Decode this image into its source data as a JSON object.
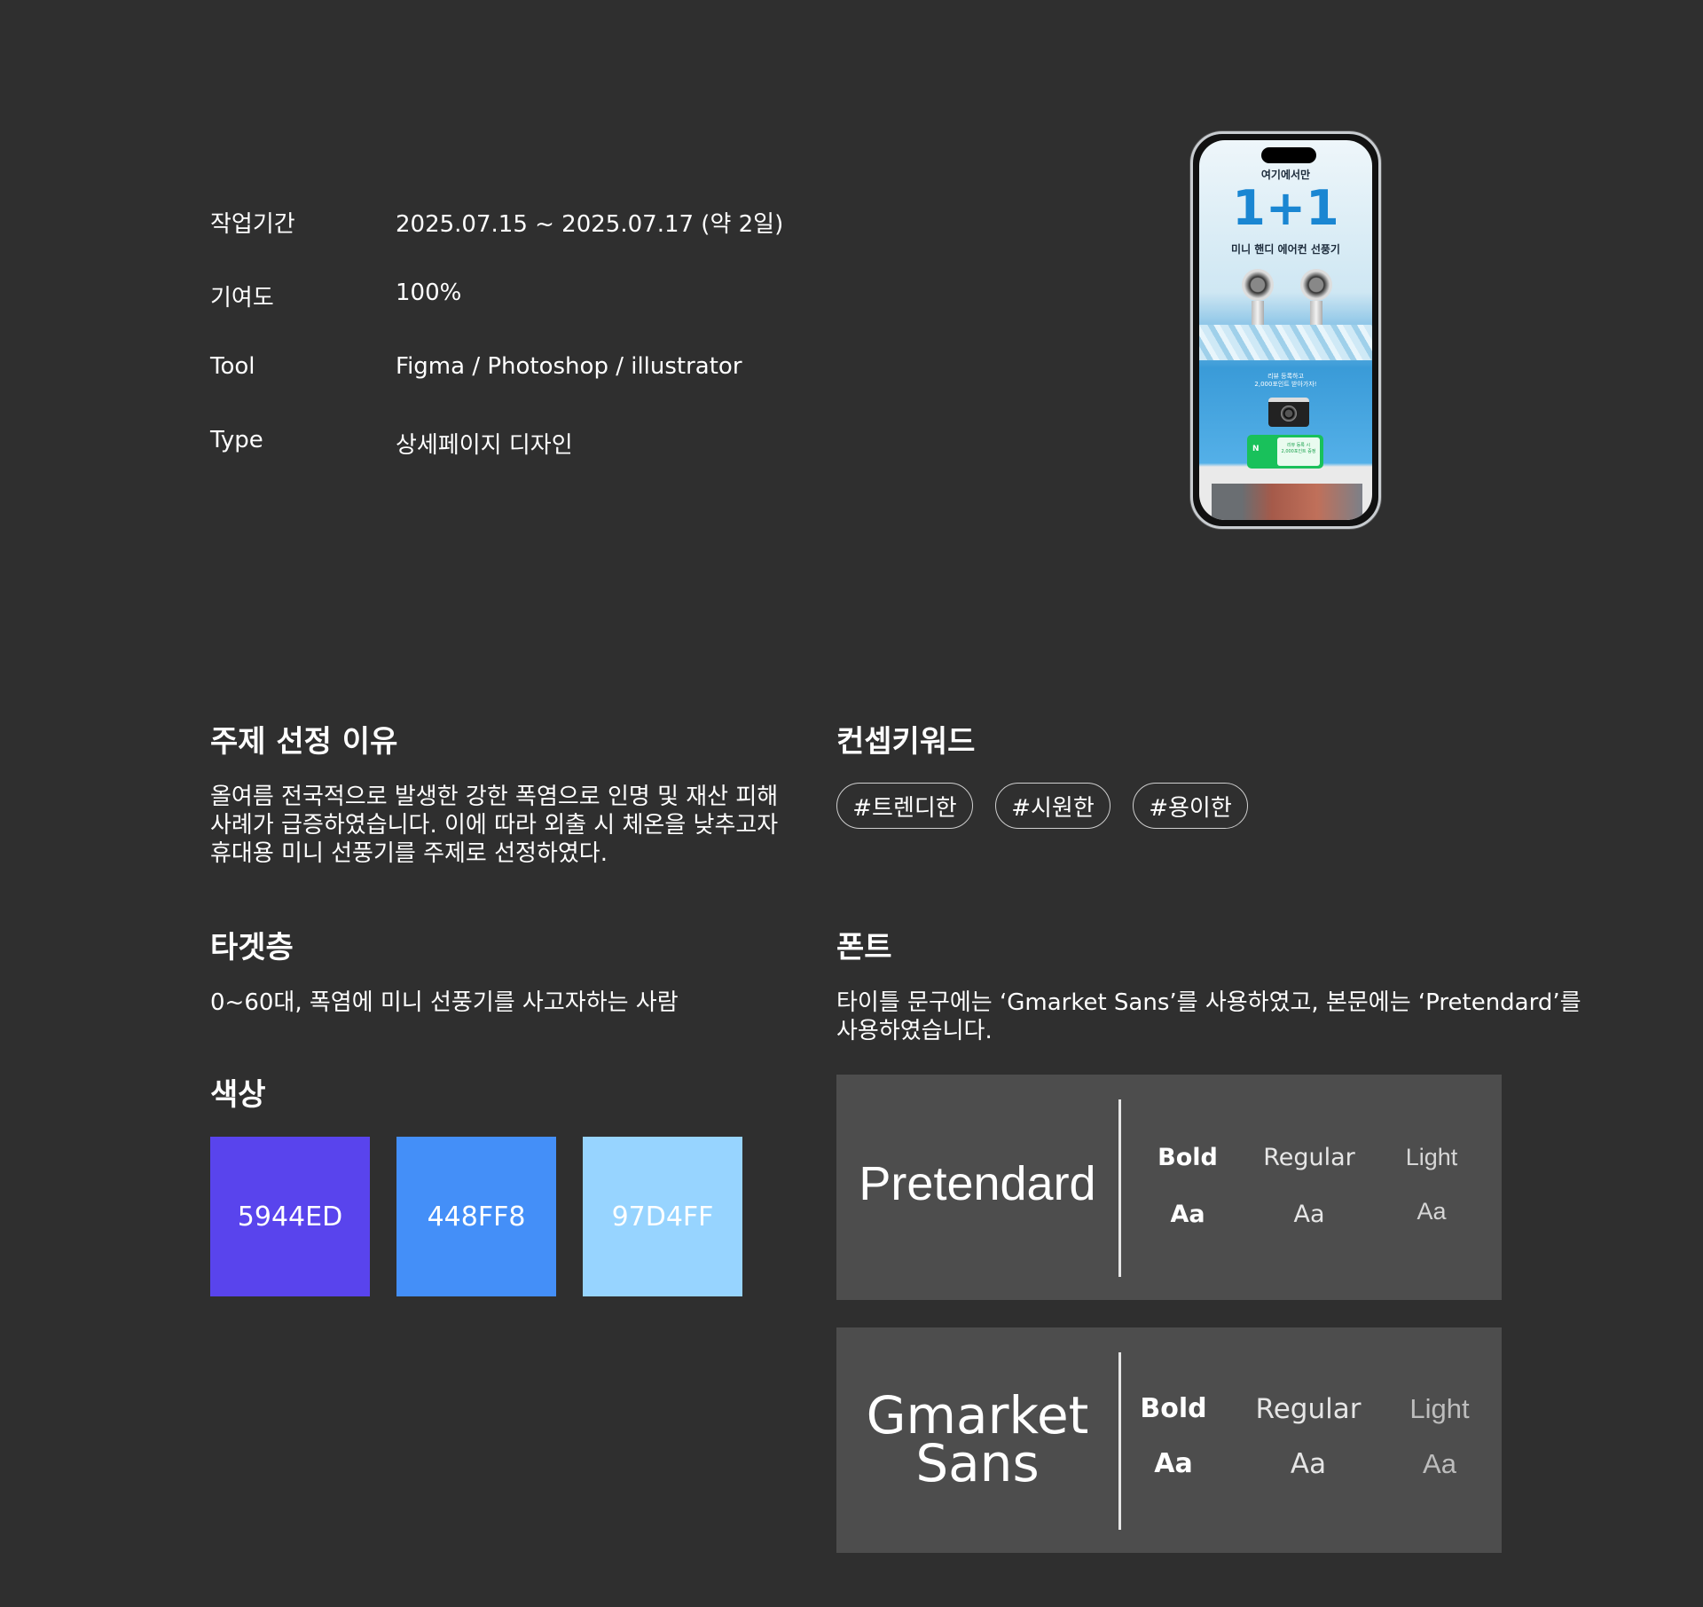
{
  "info": [
    {
      "label": "작업기간",
      "value": "2025.07.15 ~ 2025.07.17 (약 2일)"
    },
    {
      "label": "기여도",
      "value": "100%"
    },
    {
      "label": "Tool",
      "value": "Figma / Photoshop / illustrator"
    },
    {
      "label": "Type",
      "value": "상세페이지 디자인"
    }
  ],
  "phone": {
    "top_text": "여기에서만",
    "big_text": "1+1",
    "product_text": "미니 핸디 에어컨 선풍기",
    "review_line1": "리뷰 등록하고",
    "review_line2": "2,000포인트 받아가자!",
    "npay_line1": "리뷰 등록 시",
    "npay_line2": "2,000포인트 증정"
  },
  "topic": {
    "title": "주제 선정 이유",
    "lines": [
      "올여름 전국적으로 발생한 강한 폭염으로 인명 및 재산 피해",
      "사례가 급증하였습니다. 이에 따라 외출 시 체온을 낮추고자",
      "휴대용 미니 선풍기를 주제로 선정하였다."
    ]
  },
  "target": {
    "title": "타겟층",
    "text": "0~60대, 폭염에 미니 선풍기를 사고자하는 사람"
  },
  "colors": {
    "title": "색상",
    "swatches": [
      {
        "label": "5944ED",
        "hex": "#5944ED",
        "text_color": "#ffffff"
      },
      {
        "label": "448FF8",
        "hex": "#448FF8",
        "text_color": "#ffffff"
      },
      {
        "label": "97D4FF",
        "hex": "#97D4FF",
        "text_color": "#ffffff"
      }
    ]
  },
  "keywords": {
    "title": "컨셉키워드",
    "tags": [
      "#트렌디한",
      "#시원한",
      "#용이한"
    ]
  },
  "fonts": {
    "title": "폰트",
    "lines": [
      "타이틀 문구에는 ‘Gmarket Sans’를 사용하였고, 본문에는 ‘Pretendard’를",
      "사용하였습니다."
    ],
    "cards": [
      {
        "name": "Pretendard",
        "weights": [
          {
            "label": "Bold",
            "sample": "Aa"
          },
          {
            "label": "Regular",
            "sample": "Aa"
          },
          {
            "label": "Light",
            "sample": "Aa"
          }
        ]
      },
      {
        "name_line1": "Gmarket",
        "name_line2": "Sans",
        "weights": [
          {
            "label": "Bold",
            "sample": "Aa"
          },
          {
            "label": "Regular",
            "sample": "Aa"
          },
          {
            "label": "Light",
            "sample": "Aa"
          }
        ]
      }
    ]
  }
}
